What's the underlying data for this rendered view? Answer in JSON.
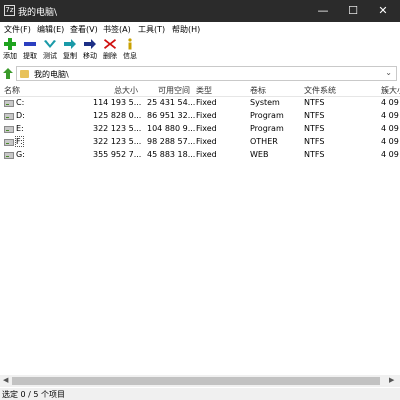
{
  "window": {
    "app_icon": "7z",
    "title": "我的电脑\\",
    "minimize_glyph": "—",
    "maximize_glyph": "☐",
    "close_glyph": "✕"
  },
  "menu": [
    "文件(F)",
    "编辑(E)",
    "查看(V)",
    "书签(A)",
    "工具(T)",
    "帮助(H)"
  ],
  "toolbar": [
    {
      "label": "添加",
      "icon": "plus-icon",
      "color": "#1fa31f"
    },
    {
      "label": "提取",
      "icon": "minus-icon",
      "color": "#2b3fc0"
    },
    {
      "label": "测试",
      "icon": "check-icon",
      "color": "#1a9aa8"
    },
    {
      "label": "复制",
      "icon": "double-arrow-icon",
      "color": "#1a9aa8"
    },
    {
      "label": "移动",
      "icon": "arrow-right-icon",
      "color": "#1c2f86"
    },
    {
      "label": "删除",
      "icon": "x-icon",
      "color": "#d01010"
    },
    {
      "label": "信息",
      "icon": "info-icon",
      "color": "#c8a000"
    }
  ],
  "address": {
    "path": "我的电脑\\",
    "chevron": "⌄",
    "up_icon": "up-arrow-icon"
  },
  "columns": [
    "名称",
    "总大小",
    "可用空间",
    "类型",
    "卷标",
    "文件系统",
    "簇大小"
  ],
  "drives": [
    {
      "name": "C:",
      "total": "114 193 5...",
      "free": "25 431 54...",
      "type": "Fixed",
      "label": "System",
      "fs": "NTFS",
      "cluster": "4 09"
    },
    {
      "name": "D:",
      "total": "125 828 0...",
      "free": "86 951 32...",
      "type": "Fixed",
      "label": "Program",
      "fs": "NTFS",
      "cluster": "4 09"
    },
    {
      "name": "E:",
      "total": "322 123 5...",
      "free": "104 880 9...",
      "type": "Fixed",
      "label": "Program",
      "fs": "NTFS",
      "cluster": "4 09"
    },
    {
      "name": "F:",
      "total": "322 123 5...",
      "free": "98 288 57...",
      "type": "Fixed",
      "label": "OTHER",
      "fs": "NTFS",
      "cluster": "4 09"
    },
    {
      "name": "G:",
      "total": "355 952 7...",
      "free": "45 883 18...",
      "type": "Fixed",
      "label": "WEB",
      "fs": "NTFS",
      "cluster": "4 09"
    }
  ],
  "scroll": {
    "left_glyph": "◀",
    "right_glyph": "▶"
  },
  "status": "选定 0 / 5 个项目"
}
